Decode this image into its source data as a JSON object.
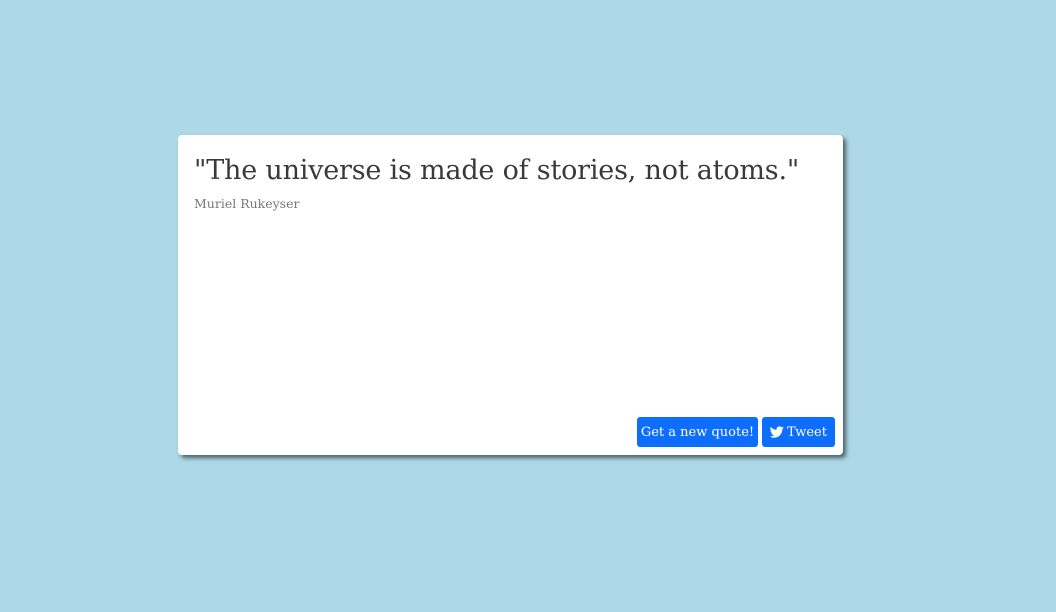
{
  "quote": {
    "text": "\"The universe is made of stories, not atoms.\"",
    "author": "Muriel Rukeyser"
  },
  "actions": {
    "new_quote_label": "Get a new quote!",
    "tweet_label": "Tweet",
    "tweet_icon": "twitter-bird-icon"
  },
  "colors": {
    "background": "#add8e6",
    "card": "#ffffff",
    "button": "#0d6efd",
    "button_text": "#ffffff"
  }
}
